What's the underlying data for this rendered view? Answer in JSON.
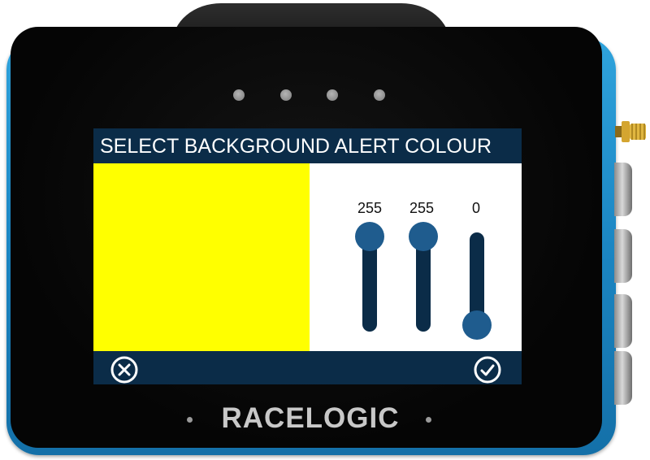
{
  "screen": {
    "title": "SELECT BACKGROUND ALERT COLOUR",
    "swatch_color": "#ffff00",
    "header_color": "#0b2c48",
    "knob_color": "#1f5c8e",
    "sliders": [
      {
        "channel": "red",
        "value": "255",
        "fraction": 1.0
      },
      {
        "channel": "green",
        "value": "255",
        "fraction": 1.0
      },
      {
        "channel": "blue",
        "value": "0",
        "fraction": 0.0
      }
    ],
    "cancel_icon": "close-circle-icon",
    "confirm_icon": "check-circle-icon"
  },
  "device": {
    "brand": "RACELOGIC",
    "body_color": "#1b86c3"
  }
}
